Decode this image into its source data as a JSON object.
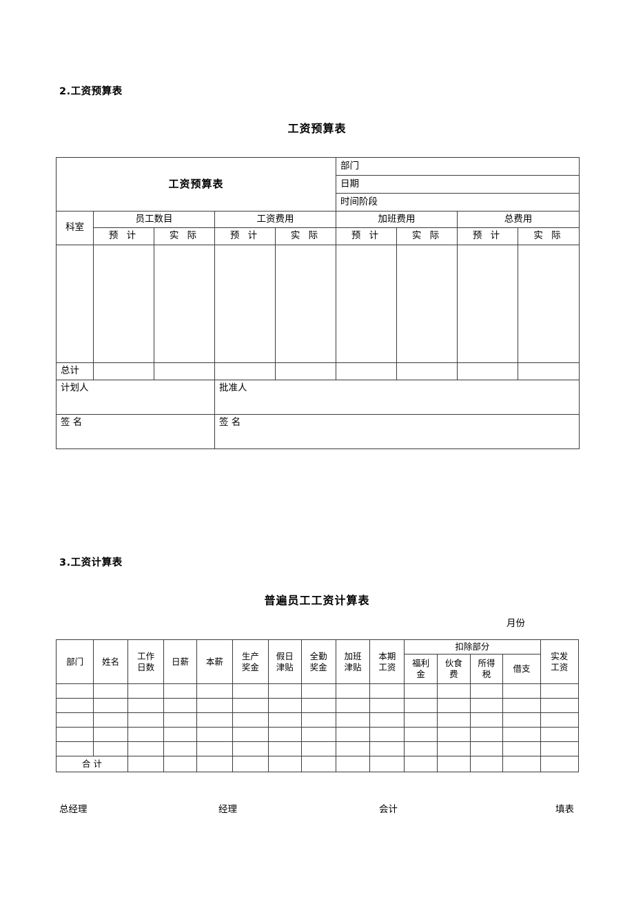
{
  "document": {
    "section2": {
      "heading": "2.工资预算表",
      "title": "工资预算表"
    },
    "section3": {
      "heading": "3.工资计算表",
      "title": "普遍员工工资计算表",
      "month_label": "月份"
    }
  },
  "budget_table": {
    "title_cell": "工资预算表",
    "info_rows": [
      "部门",
      "日期",
      "时间阶段"
    ],
    "first_col_header": "科室",
    "group_headers": [
      "员工数目",
      "工资费用",
      "加班费用",
      "总费用"
    ],
    "sub_headers": [
      "预 计",
      "实 际"
    ],
    "total_label": "总计",
    "body_rows": 1,
    "signature_rows": [
      {
        "left": "计划人",
        "right": "批准人"
      },
      {
        "left": "签  名",
        "right": "签  名"
      }
    ]
  },
  "payroll_table": {
    "headers": [
      {
        "label": "部门",
        "lines": [
          "部门"
        ]
      },
      {
        "label": "姓名",
        "lines": [
          "姓名"
        ]
      },
      {
        "label": "工作日数",
        "lines": [
          "工作",
          "日数"
        ]
      },
      {
        "label": "日薪",
        "lines": [
          "日薪"
        ]
      },
      {
        "label": "本薪",
        "lines": [
          "本薪"
        ]
      },
      {
        "label": "生产奖金",
        "lines": [
          "生产",
          "奖金"
        ]
      },
      {
        "label": "假日津贴",
        "lines": [
          "假日",
          "津贴"
        ]
      },
      {
        "label": "全勤奖金",
        "lines": [
          "全勤",
          "奖金"
        ]
      },
      {
        "label": "加班津贴",
        "lines": [
          "加班",
          "津贴"
        ]
      },
      {
        "label": "本期工资",
        "lines": [
          "本期",
          "工资"
        ]
      }
    ],
    "deduction_group": "扣除部分",
    "deduction_headers": [
      {
        "label": "福利金",
        "lines": [
          "福利",
          "金"
        ]
      },
      {
        "label": "伙食费",
        "lines": [
          "伙食",
          "费"
        ]
      },
      {
        "label": "所得税",
        "lines": [
          "所得",
          "税"
        ]
      },
      {
        "label": "借支",
        "lines": [
          "借支"
        ]
      }
    ],
    "net_header": {
      "label": "实发工资",
      "lines": [
        "实发",
        "工资"
      ]
    },
    "body_rows": 5,
    "total_label": "合    计"
  },
  "footer_signatures": [
    "总经理",
    "经理",
    "会计",
    "填表"
  ],
  "colors": {
    "page_background": "#ffffff",
    "text": "#000000",
    "border": "#3a3a3a"
  }
}
